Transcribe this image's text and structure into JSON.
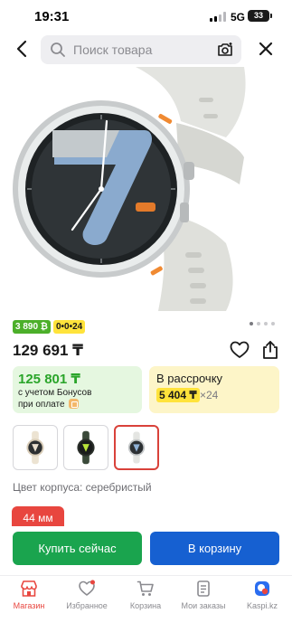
{
  "status_bar": {
    "time": "19:31",
    "network": "5G",
    "battery": "33"
  },
  "header": {
    "search_placeholder": "Поиск товара",
    "icons": [
      "back-arrow-icon",
      "search-icon",
      "camera-search-icon",
      "close-icon"
    ]
  },
  "carousel": {
    "slides": 4,
    "active_index": 0
  },
  "badges": {
    "bonus": "3 890 ₿",
    "installment": "0•0•24"
  },
  "product": {
    "price": "129 691 ₸",
    "case_color_label": "Цвет корпуса: серебристый",
    "size_label": "44 мм"
  },
  "bonus_card": {
    "amount": "125 801 ₸",
    "note_line1": "с учетом Бонусов",
    "note_line2": "при оплате"
  },
  "installment_card": {
    "title": "В рассрочку",
    "amount": "5 404 ₸",
    "months": "×24"
  },
  "variants": [
    {
      "name": "cream",
      "selected": false
    },
    {
      "name": "green",
      "selected": false
    },
    {
      "name": "silver",
      "selected": true
    }
  ],
  "actions": {
    "buy_now": "Купить сейчас",
    "add_to_cart": "В корзину"
  },
  "tabs": [
    {
      "label": "Магазин",
      "icon": "shop-icon",
      "active": true
    },
    {
      "label": "Избранное",
      "icon": "favorites-heart-icon",
      "active": false
    },
    {
      "label": "Корзина",
      "icon": "cart-icon",
      "active": false
    },
    {
      "label": "Мои заказы",
      "icon": "orders-icon",
      "active": false
    },
    {
      "label": "Kaspi.kz",
      "icon": "kaspi-icon",
      "active": false
    }
  ],
  "colors": {
    "brand_red": "#e8463f",
    "buy_green": "#1aa44e",
    "cart_blue": "#1660d1",
    "bonus_green": "#2aa52a",
    "installment_yellow": "#ffe33b"
  }
}
